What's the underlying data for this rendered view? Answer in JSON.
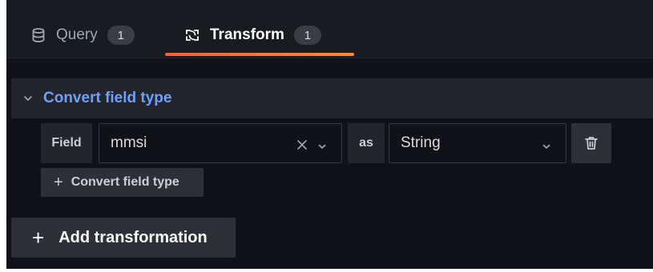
{
  "tabs": [
    {
      "label": "Query",
      "count": "1",
      "icon": "database-icon"
    },
    {
      "label": "Transform",
      "count": "1",
      "icon": "transform-icon"
    }
  ],
  "transformation": {
    "title": "Convert field type",
    "field_label": "Field",
    "field_value": "mmsi",
    "as_label": "as",
    "type_value": "String",
    "add_convert_label": "Convert field type"
  },
  "add_transformation_label": "Add transformation",
  "colors": {
    "accent_blue": "#6e9fff",
    "tab_underline": "#f55f3e",
    "background": "#111217"
  }
}
